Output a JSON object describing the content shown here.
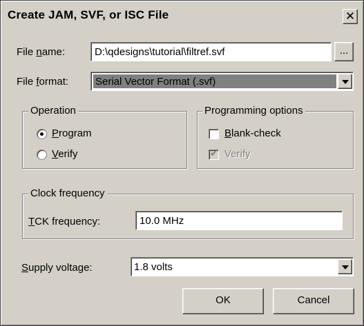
{
  "window": {
    "title": "Create JAM, SVF, or ISC File",
    "close_glyph": "✕"
  },
  "file_name": {
    "label_pre": "File ",
    "label_u": "n",
    "label_post": "ame:",
    "value": "D:\\qdesigns\\tutorial\\filtref.svf",
    "browse_label": "..."
  },
  "file_format": {
    "label_pre": "File ",
    "label_u": "f",
    "label_post": "ormat:",
    "value": "Serial Vector Format (.svf)"
  },
  "operation": {
    "title": "Operation",
    "program": {
      "u": "P",
      "rest": "rogram",
      "selected": true
    },
    "verify": {
      "u": "V",
      "rest": "erify",
      "selected": false
    }
  },
  "programming_options": {
    "title": "Programming options",
    "blank_check": {
      "u": "B",
      "rest": "lank-check",
      "checked": false
    },
    "verify": {
      "label": "Verify",
      "checked": true,
      "disabled": true
    }
  },
  "clock": {
    "title": "Clock frequency",
    "label_u": "T",
    "label_rest": "CK frequency:",
    "value": "10.0 MHz"
  },
  "supply": {
    "label_u": "S",
    "label_rest": "upply voltage:",
    "value": "1.8 volts"
  },
  "buttons": {
    "ok": "OK",
    "cancel": "Cancel"
  }
}
